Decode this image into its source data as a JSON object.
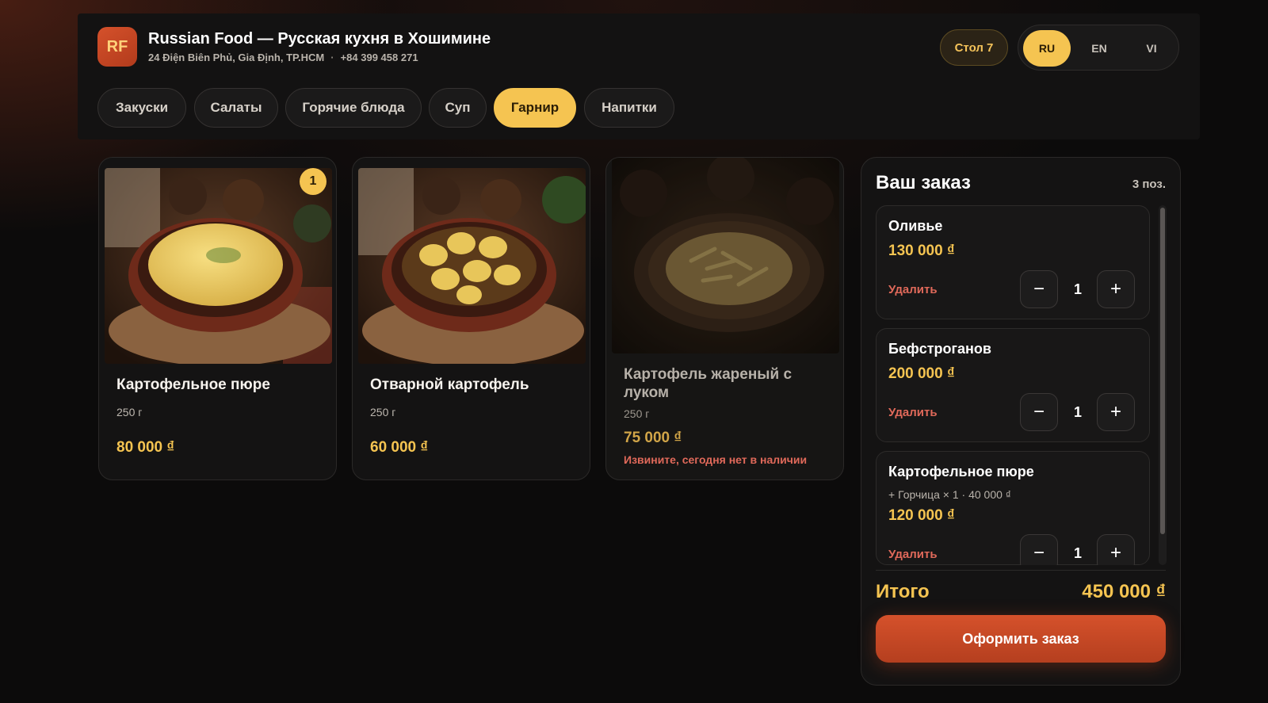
{
  "restaurant": {
    "logo_text": "RF",
    "title": "Russian Food — Русская кухня в Хошимине",
    "address": "24 Điện Biên Phủ, Gia Định, TP.HCM",
    "phone": "+84 399 458 271",
    "separator": "·"
  },
  "table_label": "Стол 7",
  "languages": [
    {
      "code": "RU",
      "active": true
    },
    {
      "code": "EN",
      "active": false
    },
    {
      "code": "VI",
      "active": false
    }
  ],
  "categories": [
    {
      "label": "Закуски",
      "active": false
    },
    {
      "label": "Салаты",
      "active": false
    },
    {
      "label": "Горячие блюда",
      "active": false
    },
    {
      "label": "Суп",
      "active": false
    },
    {
      "label": "Гарнир",
      "active": true
    },
    {
      "label": "Напитки",
      "active": false
    }
  ],
  "dishes": [
    {
      "name": "Картофельное пюре",
      "weight": "250 г",
      "price": "80 000 ₫",
      "in_cart": "1",
      "available": true,
      "image": "mashed-potatoes"
    },
    {
      "name": "Отварной картофель",
      "weight": "250 г",
      "price": "60 000 ₫",
      "in_cart": "",
      "available": true,
      "image": "boiled-potatoes"
    },
    {
      "name": "Картофель жареный с луком",
      "weight": "250 г",
      "price": "75 000 ₫",
      "in_cart": "",
      "available": false,
      "unavailable_note": "Извините, сегодня нет в наличии",
      "image": "fried-potatoes-onion"
    }
  ],
  "order": {
    "title": "Ваш заказ",
    "count": "3 поз.",
    "remove_label": "Удалить",
    "minus": "−",
    "plus": "+",
    "items": [
      {
        "name": "Оливье",
        "extra": "",
        "price": "130 000 ₫",
        "qty": "1"
      },
      {
        "name": "Бефстроганов",
        "extra": "",
        "price": "200 000 ₫",
        "qty": "1"
      },
      {
        "name": "Картофельное пюре",
        "extra": "+ Горчица × 1 · 40 000 ₫",
        "price": "120 000 ₫",
        "qty": "1"
      }
    ],
    "total_label": "Итого",
    "total_value": "450 000 ₫",
    "checkout_label": "Оформить заказ"
  },
  "colors": {
    "accent": "#f5c451",
    "brand": "#c84a27",
    "danger": "#e0695a",
    "background": "#0c0b0b"
  }
}
